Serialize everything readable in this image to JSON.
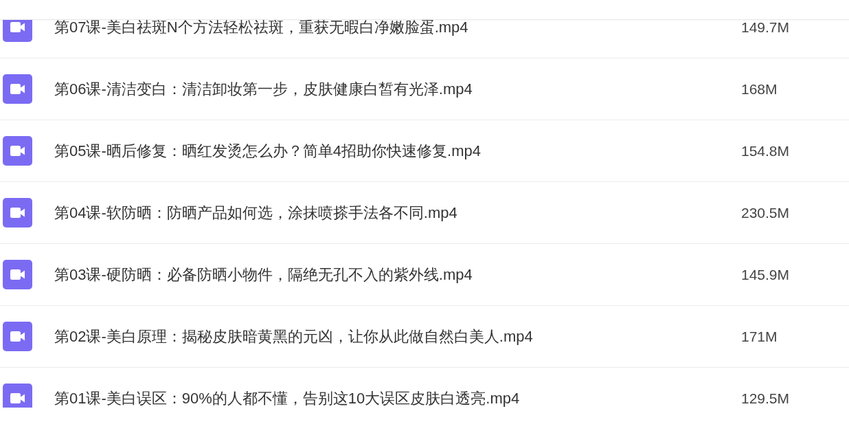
{
  "files": [
    {
      "name": "第07课-美白祛斑N个方法轻松祛斑，重获无暇白净嫩脸蛋.mp4",
      "size": "149.7M"
    },
    {
      "name": "第06课-清洁变白：清洁卸妆第一步，皮肤健康白皙有光泽.mp4",
      "size": "168M"
    },
    {
      "name": "第05课-晒后修复：晒红发烫怎么办？简单4招助你快速修复.mp4",
      "size": "154.8M"
    },
    {
      "name": "第04课-软防晒：防晒产品如何选，涂抹喷搽手法各不同.mp4",
      "size": "230.5M"
    },
    {
      "name": "第03课-硬防晒：必备防晒小物件，隔绝无孔不入的紫外线.mp4",
      "size": "145.9M"
    },
    {
      "name": "第02课-美白原理：揭秘皮肤暗黄黑的元凶，让你从此做自然白美人.mp4",
      "size": "171M"
    },
    {
      "name": "第01课-美白误区：90%的人都不懂，告别这10大误区皮肤白透亮.mp4",
      "size": "129.5M"
    }
  ]
}
